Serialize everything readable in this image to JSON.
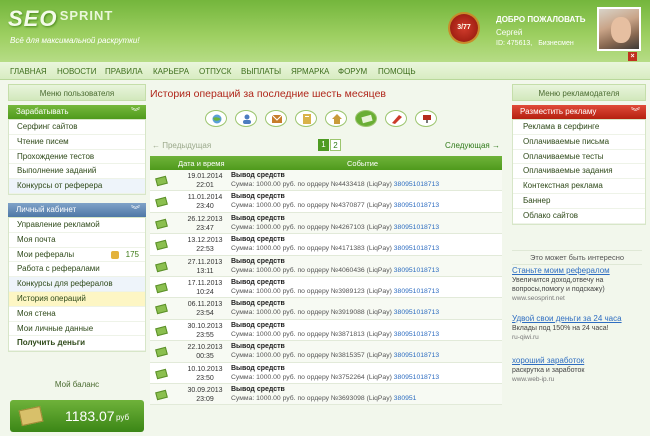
{
  "header": {
    "logo_main": "SEO",
    "logo_sub": "SPRINT",
    "tagline": "Всё для максимальной раскрутки!",
    "badge": "3/77",
    "welcome": "ДОБРО ПОЖАЛОВАТЬ",
    "username": "Сергей",
    "user_id": "ID: 475613,",
    "user_type": "Бизнесмен",
    "close": "×"
  },
  "nav": [
    "ГЛАВНАЯ",
    "НОВОСТИ",
    "ПРАВИЛА",
    "КАРЬЕРА",
    "ОТПУСК",
    "ВЫПЛАТЫ",
    "ЯРМАРКА",
    "ФОРУМ",
    "ПОМОЩЬ"
  ],
  "left": {
    "header": "Меню пользователя",
    "earn": {
      "title": "Зарабатывать",
      "items": [
        "Серфинг сайтов",
        "Чтение писем",
        "Прохождение тестов",
        "Выполнение заданий",
        "Конкурсы от реферера"
      ]
    },
    "cabinet": {
      "title": "Личный кабинет",
      "items": [
        "Управление рекламой",
        "Моя почта",
        "Мои рефералы",
        "Работа с рефералами",
        "Конкурсы для рефералов",
        "История операций",
        "Моя стена",
        "Мои личные данные",
        "Получить деньги"
      ],
      "referrals_count": "175"
    },
    "balance_title": "Мой баланс",
    "balance_amount": "1183.07",
    "balance_currency": "руб"
  },
  "main": {
    "title": "История операций за последние шесть месяцев",
    "prev": "← Предыдущая",
    "next": "Следующая →",
    "pages": [
      "1",
      "2"
    ],
    "col_date": "Дата и время",
    "col_event": "Событие",
    "rows": [
      {
        "date": "19.01.2014",
        "time": "22:01",
        "title": "Вывод средств",
        "desc": "Сумма: 1000.00 руб. по ордеру №4433418 (LiqPay)",
        "num": "380951018713"
      },
      {
        "date": "11.01.2014",
        "time": "23:40",
        "title": "Вывод средств",
        "desc": "Сумма: 1000.00 руб. по ордеру №4370877 (LiqPay)",
        "num": "380951018713"
      },
      {
        "date": "26.12.2013",
        "time": "23:47",
        "title": "Вывод средств",
        "desc": "Сумма: 1000.00 руб. по ордеру №4267103 (LiqPay)",
        "num": "380951018713"
      },
      {
        "date": "13.12.2013",
        "time": "22:53",
        "title": "Вывод средств",
        "desc": "Сумма: 1000.00 руб. по ордеру №4171383 (LiqPay)",
        "num": "380951018713"
      },
      {
        "date": "27.11.2013",
        "time": "13:11",
        "title": "Вывод средств",
        "desc": "Сумма: 1000.00 руб. по ордеру №4060436 (LiqPay)",
        "num": "380951018713"
      },
      {
        "date": "17.11.2013",
        "time": "10:24",
        "title": "Вывод средств",
        "desc": "Сумма: 1000.00 руб. по ордеру №3989123 (LiqPay)",
        "num": "380951018713"
      },
      {
        "date": "06.11.2013",
        "time": "23:54",
        "title": "Вывод средств",
        "desc": "Сумма: 1000.00 руб. по ордеру №3919088 (LiqPay)",
        "num": "380951018713"
      },
      {
        "date": "30.10.2013",
        "time": "23:55",
        "title": "Вывод средств",
        "desc": "Сумма: 1000.00 руб. по ордеру №3871813 (LiqPay)",
        "num": "380951018713"
      },
      {
        "date": "22.10.2013",
        "time": "00:35",
        "title": "Вывод средств",
        "desc": "Сумма: 1000.00 руб. по ордеру №3815357 (LiqPay)",
        "num": "380951018713"
      },
      {
        "date": "10.10.2013",
        "time": "23:50",
        "title": "Вывод средств",
        "desc": "Сумма: 1000.00 руб. по ордеру №3752264 (LiqPay)",
        "num": "380951018713"
      },
      {
        "date": "30.09.2013",
        "time": "23:09",
        "title": "Вывод средств",
        "desc": "Сумма: 1000.00 руб. по ордеру №3693098 (LiqPay)",
        "num": "380951"
      }
    ]
  },
  "right": {
    "header": "Меню рекламодателя",
    "ads": {
      "title": "Разместить рекламу",
      "items": [
        "Реклама в серфинге",
        "Оплачиваемые письма",
        "Оплачиваемые тесты",
        "Оплачиваемые задания",
        "Контекстная реклама",
        "Баннер",
        "Облако сайтов"
      ]
    },
    "interest_title": "Это может быть интересно",
    "promos": [
      {
        "title": "Станьте моим рефералом",
        "desc": "Увеличится доход,отвечу на вопросы,помогу и подскажу)",
        "url": "www.seosprint.net"
      },
      {
        "title": "Удвой свои деньги за 24 часа",
        "desc": "Вклады под 150% на 24 часа!",
        "url": "ru-qiwi.ru"
      },
      {
        "title": "хороший заработок",
        "desc": "раскрутка и заработок",
        "url": "www.web-ip.ru"
      }
    ]
  },
  "colors": {
    "accent_green": "#4f9a1c",
    "title_red": "#b0261a",
    "link_blue": "#2e6dc1"
  }
}
